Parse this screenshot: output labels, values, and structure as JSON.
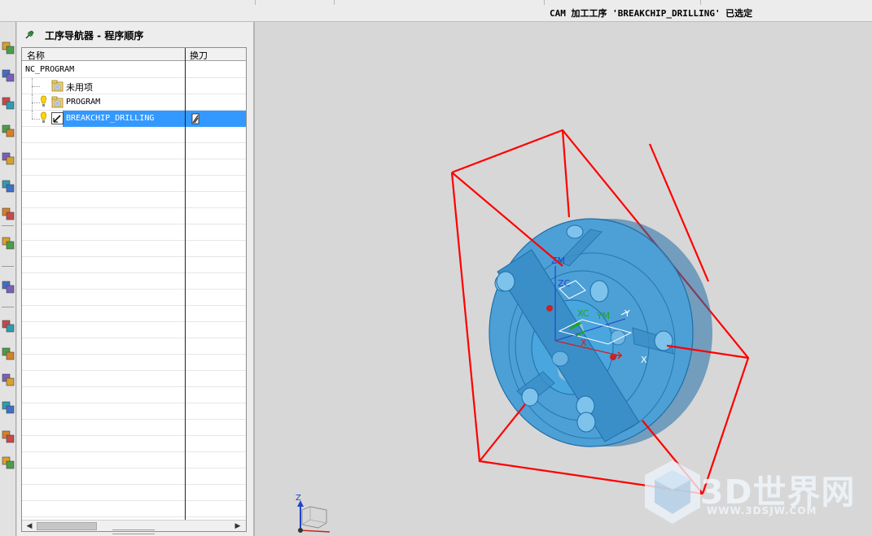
{
  "statusbar": {
    "message": "CAM 加工工序 'BREAKCHIP_DRILLING' 已选定"
  },
  "navigator": {
    "title": "工序导航器 - 程序顺序",
    "columns": {
      "name": "名称",
      "tool_change": "换刀"
    },
    "rows": [
      {
        "name": "NC_PROGRAM",
        "indent": 0,
        "icon": "none",
        "status": "none",
        "tool_change": "",
        "selected": false
      },
      {
        "name": "未用项",
        "indent": 1,
        "icon": "folder-icon",
        "status": "none",
        "tool_change": "",
        "selected": false
      },
      {
        "name": "PROGRAM",
        "indent": 1,
        "icon": "folder-icon",
        "status": "warning",
        "tool_change": "",
        "selected": false
      },
      {
        "name": "BREAKCHIP_DRILLING",
        "indent": 1,
        "icon": "drilling-operation-icon",
        "status": "warning",
        "tool_change": "drill-tool-icon",
        "selected": true
      }
    ],
    "empty_row_count": 24
  },
  "resource_bar": {
    "icons": [
      "operation-navigator-icon",
      "machine-tool-navigator-icon",
      "part-navigator-icon",
      "assembly-navigator-icon",
      "constraint-navigator-icon",
      "reuse-library-icon",
      "palette-library-icon",
      "internet-explorer-icon",
      "history-icon",
      "process-studio-icon",
      "roles-icon",
      "system-materials-icon",
      "manufacturing-wizard-icon",
      "team-icon",
      "layout-icon"
    ]
  },
  "viewport": {
    "axis_labels": {
      "zm": "ZM",
      "zc": "ZC",
      "xc": "XC",
      "ym": "YM",
      "yc": "Y",
      "x_axis": "X",
      "x_red": "X",
      "z_triad": "Z"
    },
    "colors": {
      "part": "#3d9ad6",
      "part_dark": "#1f6ea8",
      "bounding_box": "#ff0000",
      "selection": "#3399ff"
    }
  },
  "watermark": {
    "text": "3D世界网",
    "url": "WWW.3DSJW.COM"
  }
}
